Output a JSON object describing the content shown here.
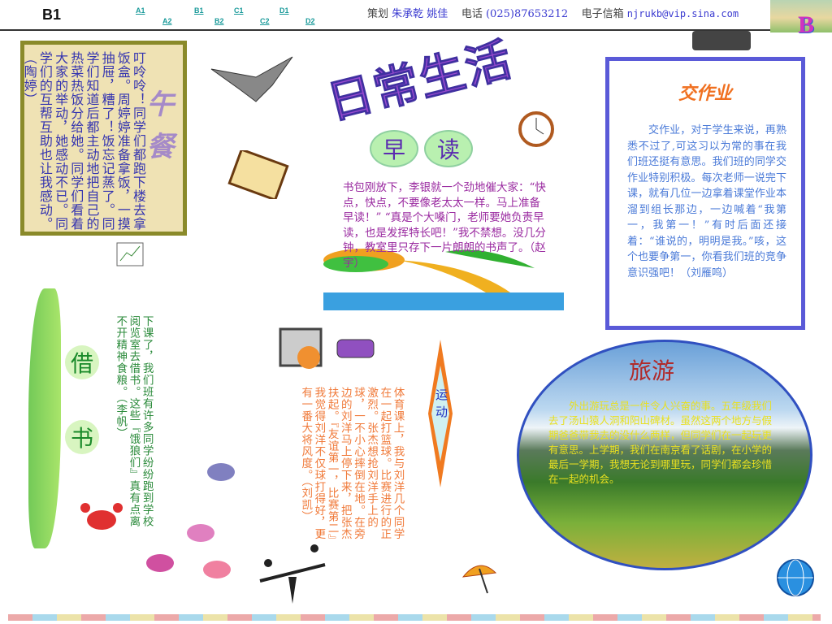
{
  "header": {
    "page_label": "B1",
    "nav": [
      "A1",
      "A2",
      "B1",
      "B2",
      "C1",
      "C2",
      "D1",
      "D2"
    ],
    "planner_label": "策划",
    "planners": "朱承乾 姚佳",
    "phone_label": "电话",
    "phone": "(025)87653212",
    "email_label": "电子信箱",
    "email": "njrukb@vip.sina.com",
    "corner_letter": "B"
  },
  "title": "日常生活",
  "lunch": {
    "title": "午餐",
    "text": "叮呤呤！同学们都跑下楼去拿饭盒。周婷婷准备拿饭，一摸抽屉，糟了！饭忘记蒸了。同学们知道后都主动地把自己的热菜热饭分给她。同学们看着大家的举动，她感动不已。同学们的互帮互助也让我感动。（陶婷）"
  },
  "reading": {
    "title_chars": [
      "早",
      "读"
    ],
    "text": "书包刚放下，李银就一个劲地催大家：“快点，快点，不要像老太太一样。马上准备早读！” “真是个大嗓门，老师要她负责早读，也是发挥特长吧！”我不禁想。没几分钟，教室里只存下一片朗朗的书声了。（赵宇）"
  },
  "homework": {
    "title": "交作业",
    "text": "交作业，对于学生来说，再熟悉不过了,可这习以为常的事在我们班还挺有意思。我们班的同学交作业特别积极。每次老师一说完下课，就有几位一边拿着课堂作业本溜到组长那边，一边喊着“我第一，我第一！”有时后面还接着：“谁说的，明明是我。”咳，这个也要争第一，你看我们班的竞争意识强吧！（刘雁鸣）"
  },
  "travel": {
    "title": "旅游",
    "text": "外出游玩总是一件令人兴奋的事。五年级我们去了汤山猿人洞和阳山碑材。虽然这两个地方与假期爸爸带我去的没什么两样，但同学们在一起玩更有意思。上学期，我们在南京看了话剧，在小学的最后一学期，我想无论到哪里玩，同学们都会珍惜在一起的机会。"
  },
  "borrow": {
    "title_chars": [
      "借",
      "书"
    ],
    "text": "下课了，我们班有许多同学纷纷跑到学校阅览室去借书。这些『饿狼们』真有点离不开精神食粮。（李帆）"
  },
  "sports": {
    "title": "运动",
    "text": "体育课上，我与刘洋几个同学在一起打篮球。比赛进行的正激烈。张杰想抢刘洋手上的球，一不小心摔倒在地。在旁边的刘洋马上停下来，把张杰扶起。『友谊第一，比赛第二』我觉得刘洋不仅球打得好，更有一番大将风度。（刘凯）"
  }
}
